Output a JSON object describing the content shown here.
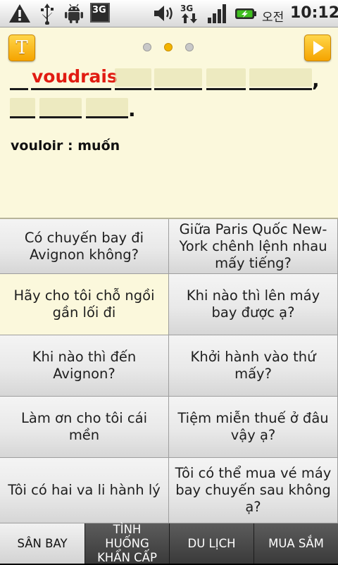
{
  "status_bar": {
    "icons": [
      "warning-icon",
      "usb-icon",
      "android-debug-icon",
      "3g-icon",
      "volume-icon",
      "3g-data-icon",
      "signal-icon",
      "battery-charging-icon"
    ],
    "network_label": "3G",
    "am_pm": "오전",
    "time": "10:12"
  },
  "card": {
    "text_button_label": "T",
    "pager": {
      "count": 3,
      "active_index": 1
    },
    "answer_word": "voudrais",
    "comma": ",",
    "period": ".",
    "vocab": "vouloir : muốn",
    "accent": "#e11c12"
  },
  "grid": {
    "cells": [
      "Có chuyến bay đi Avignon không?",
      "Giữa Paris Quốc New-York chênh lệnh nhau mấy tiếng?",
      "Hãy cho tôi chỗ ngồi gần lối đi",
      "Khi nào thì lên máy bay được ạ?",
      "Khi nào thì đến Avignon?",
      "Khởi hành vào thứ mấy?",
      "Làm ơn cho tôi cái mền",
      "Tiệm miễn thuế ở đâu vậy ạ?",
      "Tôi có hai va li hành lý",
      "Tôi có thể mua vé máy bay chuyến sau không ạ?"
    ],
    "selected_index": 2
  },
  "tabs": {
    "items": [
      "SÂN BAY",
      "TÌNH HUỐNG KHẨN CẤP",
      "DU LỊCH",
      "MUA SẮM"
    ],
    "active_index": 0
  }
}
